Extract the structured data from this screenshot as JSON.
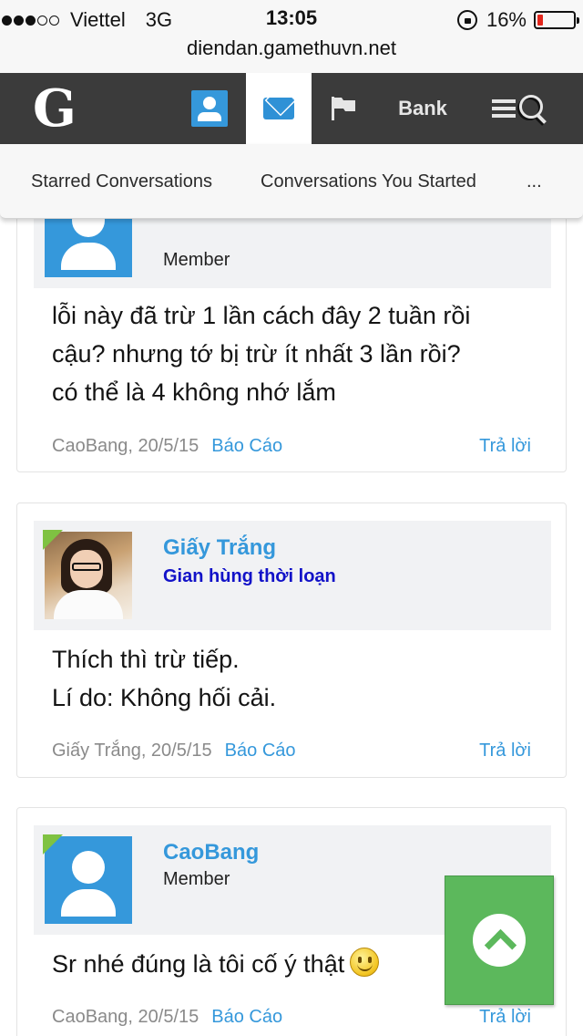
{
  "status_bar": {
    "carrier": "Viettel",
    "network": "3G",
    "time": "13:05",
    "battery_percent": "16%",
    "battery_level": 0.16,
    "battery_color": "#e3261c",
    "signal_bars": 3,
    "signal_max": 5
  },
  "address_bar": {
    "url": "diendan.gamethuvn.net"
  },
  "navbar": {
    "logo": "G",
    "bank_label": "Bank",
    "icons": [
      "user-icon",
      "envelope-icon",
      "flag-icon",
      "menu-icon",
      "search-icon"
    ],
    "accent_color": "#3598db"
  },
  "submenu": {
    "items": [
      "Starred Conversations",
      "Conversations You Started",
      "..."
    ]
  },
  "posts": [
    {
      "user_title": "Member",
      "message_lines": [
        "lỗi này đã trừ 1 lần cách đây 2 tuần rồi",
        "cậu? nhưng tớ bị trừ ít nhất 3 lần rồi?",
        "có thể là 4 không nhớ lắm"
      ],
      "author_date": "CaoBang, 20/5/15",
      "report_label": "Báo Cáo",
      "reply_label": "Trả lời"
    },
    {
      "username": "Giấy Trắng",
      "user_title": "Gian hùng thời loạn",
      "message_lines": [
        "Thích thì trừ tiếp.",
        "Lí do: Không hối cải."
      ],
      "author_date": "Giấy Trắng, 20/5/15",
      "report_label": "Báo Cáo",
      "reply_label": "Trả lời"
    },
    {
      "username": "CaoBang",
      "user_title": "Member",
      "message": "Sr nhé đúng là tôi cố ý thật",
      "author_date": "CaoBang, 20/5/15",
      "report_label": "Báo Cáo",
      "reply_label": "Trả lời"
    }
  ],
  "back_to_top": {
    "icon": "chevron-up-icon",
    "color": "#5cb85c"
  }
}
